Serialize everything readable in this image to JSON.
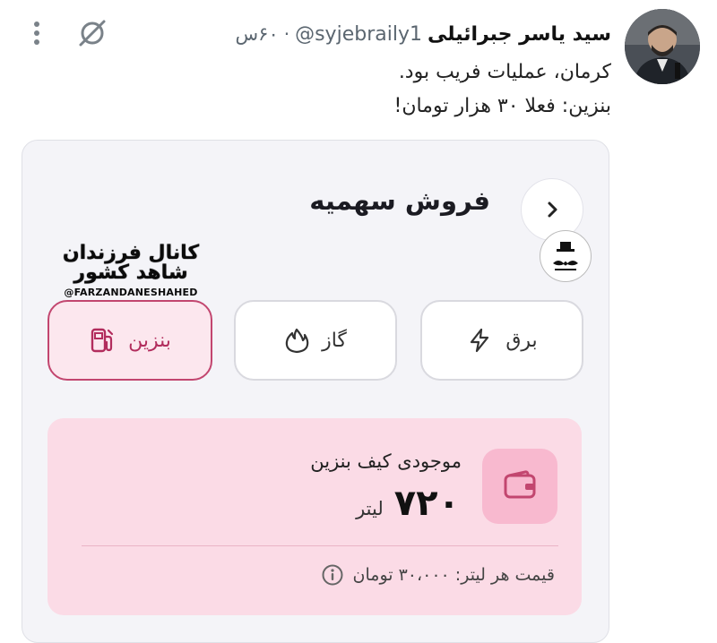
{
  "tweet": {
    "author_name": "سید یاسر جبرائیلی",
    "handle": "@syjebraily1",
    "separator": "·",
    "time": "۶۰س",
    "text_lines": [
      "کرمان، عملیات فریب بود.",
      "بنزین: فعلا ۳۰ هزار تومان!"
    ],
    "icons": {
      "mute": "mute-icon",
      "more": "more-dots-icon",
      "avatar": "avatar-photo"
    }
  },
  "app": {
    "screen_title": "فروش سهمیه",
    "back_icon": "chevron-right-icon",
    "services": [
      {
        "label": "برق",
        "icon": "lightning-icon",
        "selected": false
      },
      {
        "label": "گاز",
        "icon": "flame-icon",
        "selected": false
      },
      {
        "label": "بنزین",
        "icon": "fuel-pump-icon",
        "selected": true
      }
    ],
    "balance": {
      "label": "موجودی کیف بنزین",
      "value": "۷۲۰",
      "unit": "لیتر",
      "price_text": "قیمت هر لیتر: ۳۰،۰۰۰ تومان",
      "wallet_icon": "wallet-icon",
      "info_icon": "info-icon"
    }
  },
  "watermark": {
    "line1": "کانال فرزندان",
    "line2": "شاهد کشور",
    "handle": "@FARZANDANESHAHED"
  },
  "channel_logo": "channel-logo-icon",
  "colors": {
    "accent": "#c2466f",
    "accent_soft": "#fbdbe6",
    "card_bg": "#f4f4f8",
    "wallet_bg": "#f8b9cf"
  }
}
